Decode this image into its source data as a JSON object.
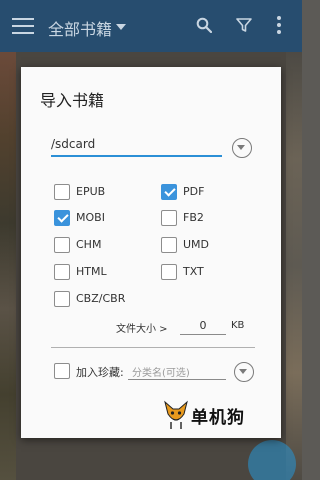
{
  "appbar": {
    "title": "全部书籍",
    "icons": [
      "menu-icon",
      "chevron-down-icon",
      "search-icon",
      "filter-icon",
      "more-vert-icon"
    ],
    "color": "#274d6f"
  },
  "dialog": {
    "title": "导入书籍",
    "path": {
      "value": "/sdcard"
    },
    "formats": [
      {
        "label": "EPUB",
        "checked": false
      },
      {
        "label": "PDF",
        "checked": true
      },
      {
        "label": "MOBI",
        "checked": true
      },
      {
        "label": "FB2",
        "checked": false
      },
      {
        "label": "CHM",
        "checked": false
      },
      {
        "label": "UMD",
        "checked": false
      },
      {
        "label": "HTML",
        "checked": false
      },
      {
        "label": "TXT",
        "checked": false
      },
      {
        "label": "CBZ/CBR",
        "checked": false
      }
    ],
    "file_size": {
      "label": "文件大小 >",
      "value": "0",
      "unit": "KB"
    },
    "favorite": {
      "label": "加入珍藏:",
      "checked": false,
      "placeholder": "分类名(可选)"
    },
    "accent_color": "#3a93dc"
  },
  "watermark": {
    "text": "单机狗"
  }
}
